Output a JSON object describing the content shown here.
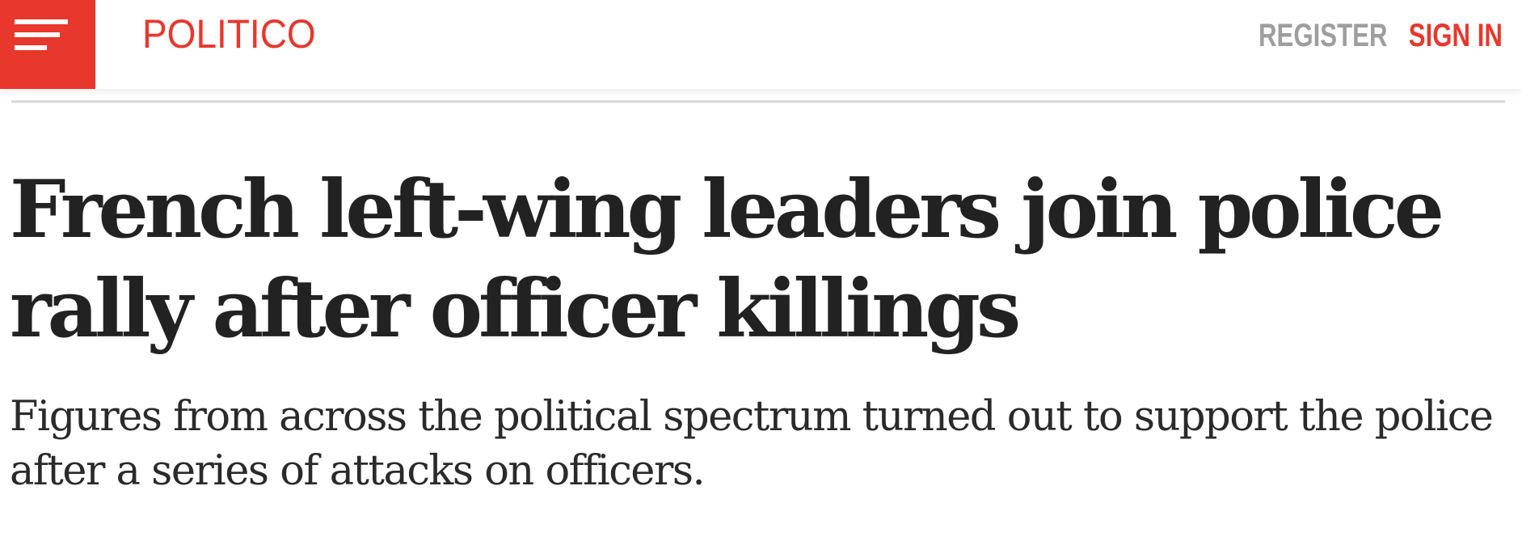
{
  "header": {
    "logo_text": "POLITICO",
    "menu_icon": "hamburger-menu-icon",
    "register_label": "REGISTER",
    "signin_label": "SIGN IN"
  },
  "article": {
    "headline": "French left-wing leaders join police rally after officer killings",
    "dek": "Figures from across the political spectrum turned out to support the police after a series of attacks on officers."
  },
  "colors": {
    "brand_red": "#e8372c",
    "register_gray": "#9e9e9e",
    "text_dark": "#222222"
  }
}
